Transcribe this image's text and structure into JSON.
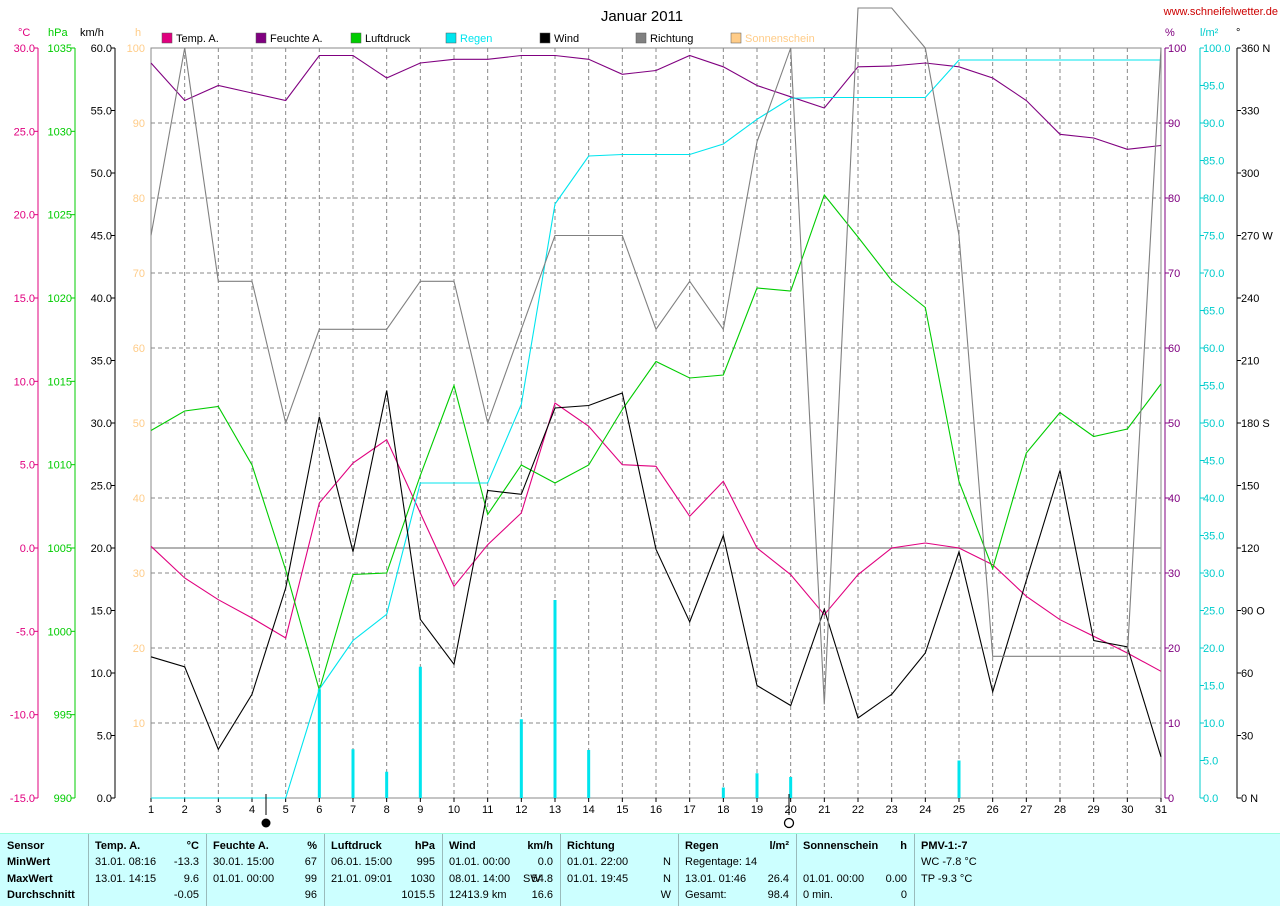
{
  "chart_data": {
    "type": "line",
    "title": "Januar 2011",
    "source": "www.schneifelwetter.de",
    "x": [
      1,
      2,
      3,
      4,
      5,
      6,
      7,
      8,
      9,
      10,
      11,
      12,
      13,
      14,
      15,
      16,
      17,
      18,
      19,
      20,
      21,
      22,
      23,
      24,
      25,
      26,
      27,
      28,
      29,
      30,
      31
    ],
    "series": [
      {
        "name": "Temp. A.",
        "color": "#e0007f",
        "axis": "temp",
        "values": [
          0.1,
          -1.8,
          -3.1,
          -4.2,
          -5.4,
          2.7,
          5.1,
          6.5,
          2.1,
          -2.3,
          0.2,
          2.1,
          8.7,
          7.3,
          5.0,
          4.9,
          1.9,
          4.0,
          0.0,
          -1.6,
          -4.0,
          -1.6,
          0.0,
          0.3,
          0.0,
          -1.0,
          -2.9,
          -4.3,
          -5.3,
          -6.3,
          -7.4
        ]
      },
      {
        "name": "Feuchte A.",
        "color": "#800080",
        "axis": "hum",
        "values": [
          98,
          93,
          95,
          94,
          93,
          99,
          99,
          96,
          98,
          98.5,
          98.5,
          99,
          99,
          98.5,
          96.5,
          97,
          99,
          97.5,
          95,
          93.5,
          92,
          97.5,
          97.6,
          98,
          97.5,
          96,
          93,
          88.5,
          88,
          86.5,
          87
        ]
      },
      {
        "name": "Luftdruck",
        "color": "#00cc00",
        "axis": "hpa",
        "values": [
          1014.5,
          1015.8,
          1016.1,
          1012.2,
          1005.2,
          997.2,
          1004.9,
          1005.0,
          1011.5,
          1017.5,
          1008.9,
          1012.2,
          1011.0,
          1012.2,
          1015.9,
          1019.1,
          1018.0,
          1018.2,
          1024.0,
          1023.8,
          1030.2,
          1027.4,
          1024.5,
          1022.7,
          1011.1,
          1005.3,
          1013.0,
          1015.7,
          1014.1,
          1014.6,
          1017.6
        ]
      },
      {
        "name": "Regen",
        "color": "#00e5ee",
        "axis": "rain",
        "values": [
          0.0,
          0.0,
          0.0,
          0.0,
          0.0,
          14.5,
          21.0,
          24.5,
          42.0,
          42.0,
          42.0,
          52.5,
          79.2,
          85.6,
          85.8,
          85.8,
          85.8,
          87.2,
          90.5,
          93.3,
          93.4,
          93.4,
          93.4,
          93.4,
          98.4,
          98.4,
          98.4,
          98.4,
          98.4,
          98.4,
          98.4
        ]
      },
      {
        "name": "Wind",
        "color": "#000000",
        "axis": "kmh",
        "values": [
          11.3,
          10.5,
          3.9,
          8.3,
          16.8,
          30.5,
          19.7,
          32.6,
          14.3,
          10.7,
          24.6,
          24.3,
          31.2,
          31.4,
          32.4,
          19.9,
          14.1,
          21.0,
          9.0,
          7.4,
          15.1,
          6.4,
          8.3,
          11.6,
          19.7,
          8.5,
          17.4,
          26.2,
          12.6,
          12.1,
          3.3
        ]
      },
      {
        "name": "Richtung",
        "color": "#808080",
        "axis": "deg",
        "values": [
          270,
          360,
          248,
          248,
          180,
          225,
          225,
          225,
          248,
          248,
          180,
          225,
          270,
          270,
          270,
          225,
          248,
          225,
          315,
          360,
          45,
          405,
          405,
          360,
          270,
          68,
          68,
          68,
          68,
          68,
          360
        ]
      },
      {
        "name": "Sonnenschein",
        "color": "#ffcc88",
        "axis": "sun",
        "values": []
      }
    ],
    "rain_daily": [
      0,
      0,
      0,
      0,
      0,
      14.5,
      6.5,
      3.5,
      17.5,
      0,
      0,
      10.5,
      26.4,
      6.4,
      0,
      0,
      0,
      1.4,
      3.3,
      2.8,
      0,
      0,
      0,
      0,
      5.0,
      0,
      0,
      0,
      0,
      0,
      0
    ],
    "axes": {
      "temp": {
        "unit": "°C",
        "min": -15,
        "max": 30,
        "color": "#e0007f",
        "ticks": [
          "30.0",
          "25.0",
          "20.0",
          "15.0",
          "10.0",
          "5.0",
          "0.0",
          "-5.0",
          "-10.0",
          "-15.0"
        ]
      },
      "hpa": {
        "unit": "hPa",
        "min": 990,
        "max": 1040,
        "color": "#00cc00",
        "ticks": [
          "1035",
          "1030",
          "1025",
          "1020",
          "1015",
          "1010",
          "1005",
          "1000",
          "995",
          "990"
        ]
      },
      "kmh": {
        "unit": "km/h",
        "min": 0,
        "max": 60,
        "color": "#000000",
        "ticks": [
          "60.0",
          "55.0",
          "50.0",
          "45.0",
          "40.0",
          "35.0",
          "30.0",
          "25.0",
          "20.0",
          "15.0",
          "10.0",
          "5.0",
          "0.0"
        ]
      },
      "sun": {
        "unit": "h",
        "min": 0,
        "max": 100,
        "color": "#ffcc88",
        "ticks": [
          "100",
          "90",
          "80",
          "70",
          "60",
          "50",
          "40",
          "30",
          "20",
          "10"
        ]
      },
      "hum": {
        "unit": "%",
        "min": 0,
        "max": 100,
        "color": "#800080",
        "ticks": [
          "100",
          "90",
          "80",
          "70",
          "60",
          "50",
          "40",
          "30",
          "20",
          "10",
          "0"
        ]
      },
      "rain": {
        "unit": "l/m²",
        "min": 0,
        "max": 100,
        "color": "#00cccc",
        "ticks": [
          "100.0",
          "95.0",
          "90.0",
          "85.0",
          "80.0",
          "75.0",
          "70.0",
          "65.0",
          "60.0",
          "55.0",
          "50.0",
          "45.0",
          "40.0",
          "35.0",
          "30.0",
          "25.0",
          "20.0",
          "15.0",
          "10.0",
          "5.0",
          "0.0"
        ]
      },
      "deg": {
        "unit": "°",
        "min": 0,
        "max": 360,
        "color": "#000000",
        "ticks": [
          "360 N",
          "330",
          "300",
          "270 W",
          "240",
          "210",
          "180 S",
          "150",
          "120",
          "90 O",
          "60",
          "30",
          "0 N"
        ]
      }
    },
    "grid": true
  },
  "stats": {
    "sensor": {
      "title": "Sensor",
      "rows": [
        "MinWert",
        "MaxWert",
        "Durchschnitt"
      ]
    },
    "temp": {
      "title": "Temp. A.",
      "unit": "°C",
      "min_date": "31.01.  08:16",
      "min_val": "-13.3",
      "max_date": "13.01.  14:15",
      "max_val": "9.6",
      "avg": "-0.05"
    },
    "hum": {
      "title": "Feuchte A.",
      "unit": "%",
      "min_date": "30.01.  15:00",
      "min_val": "67",
      "max_date": "01.01.  00:00",
      "max_val": "99",
      "avg": "96"
    },
    "press": {
      "title": "Luftdruck",
      "unit": "hPa",
      "min_date": "06.01.  15:00",
      "min_val": "995",
      "max_date": "21.01.  09:01",
      "max_val": "1030",
      "avg": "1015.5"
    },
    "wind": {
      "title": "Wind",
      "unit": "km/h",
      "min_date": "01.01.  00:00",
      "min_val": "0.0",
      "max_date": "08.01.  14:00",
      "max_dir": "SW",
      "max_val": "54.8",
      "avg_km": "12413.9 km",
      "avg": "16.6"
    },
    "dir": {
      "title": "Richtung",
      "min_date": "01.01.  22:00",
      "min_val": "N",
      "max_date": "01.01.  19:45",
      "max_val": "N",
      "avg": "W"
    },
    "rain": {
      "title": "Regen",
      "unit": "l/m²",
      "days": "Regentage: 14",
      "max_date": "13.01.  01:46",
      "max_val": "26.4",
      "total_lbl": "Gesamt:",
      "total": "98.4"
    },
    "sun": {
      "title": "Sonnenschein",
      "unit": "h",
      "max_date": "01.01.  00:00",
      "max_val": "0.00",
      "min_lbl": "0 min.",
      "min_val": "0"
    },
    "pmv": {
      "title": "PMV-1:-7",
      "wc": "WC -7.8 °C",
      "tp": "TP -9.3 °C"
    }
  }
}
